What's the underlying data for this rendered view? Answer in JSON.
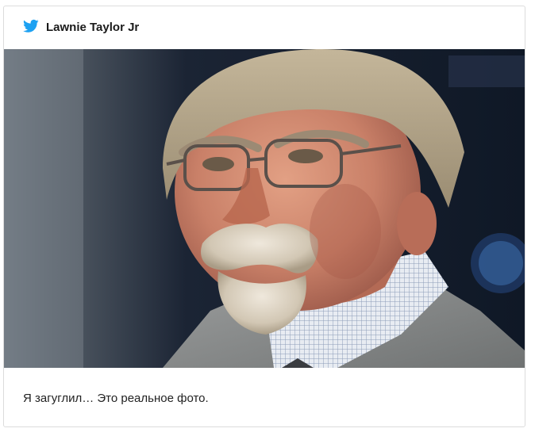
{
  "tweet": {
    "author": "Lawnie Taylor Jr",
    "icon": "twitter-bird-icon",
    "accent_color": "#1da1f2",
    "text": "Я загуглил… Это реальное фото."
  }
}
